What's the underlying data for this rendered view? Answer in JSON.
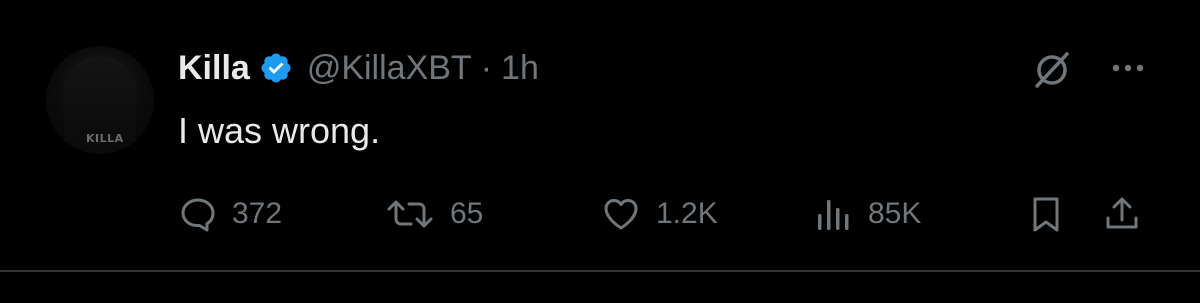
{
  "tweet": {
    "author": {
      "display_name": "Killa",
      "handle": "@KillaXBT",
      "verified": true,
      "avatar_text": "KILLA"
    },
    "separator": "·",
    "time": "1h",
    "text": "I was wrong.",
    "stats": {
      "replies": "372",
      "reposts": "65",
      "likes": "1.2K",
      "views": "85K"
    },
    "icons": {
      "reply": "comment-bubble-icon",
      "repost": "repost-arrows-icon",
      "like": "heart-icon",
      "views": "bar-chart-icon",
      "bookmark": "bookmark-icon",
      "share": "share-upload-icon",
      "grok": "grok-icon",
      "more": "more-dots-icon",
      "verified": "verified-badge-icon"
    },
    "colors": {
      "background": "#000000",
      "text_primary": "#e7e9ea",
      "text_secondary": "#71767b",
      "verified_blue": "#1d9bf0",
      "divider": "#2f3336"
    }
  }
}
